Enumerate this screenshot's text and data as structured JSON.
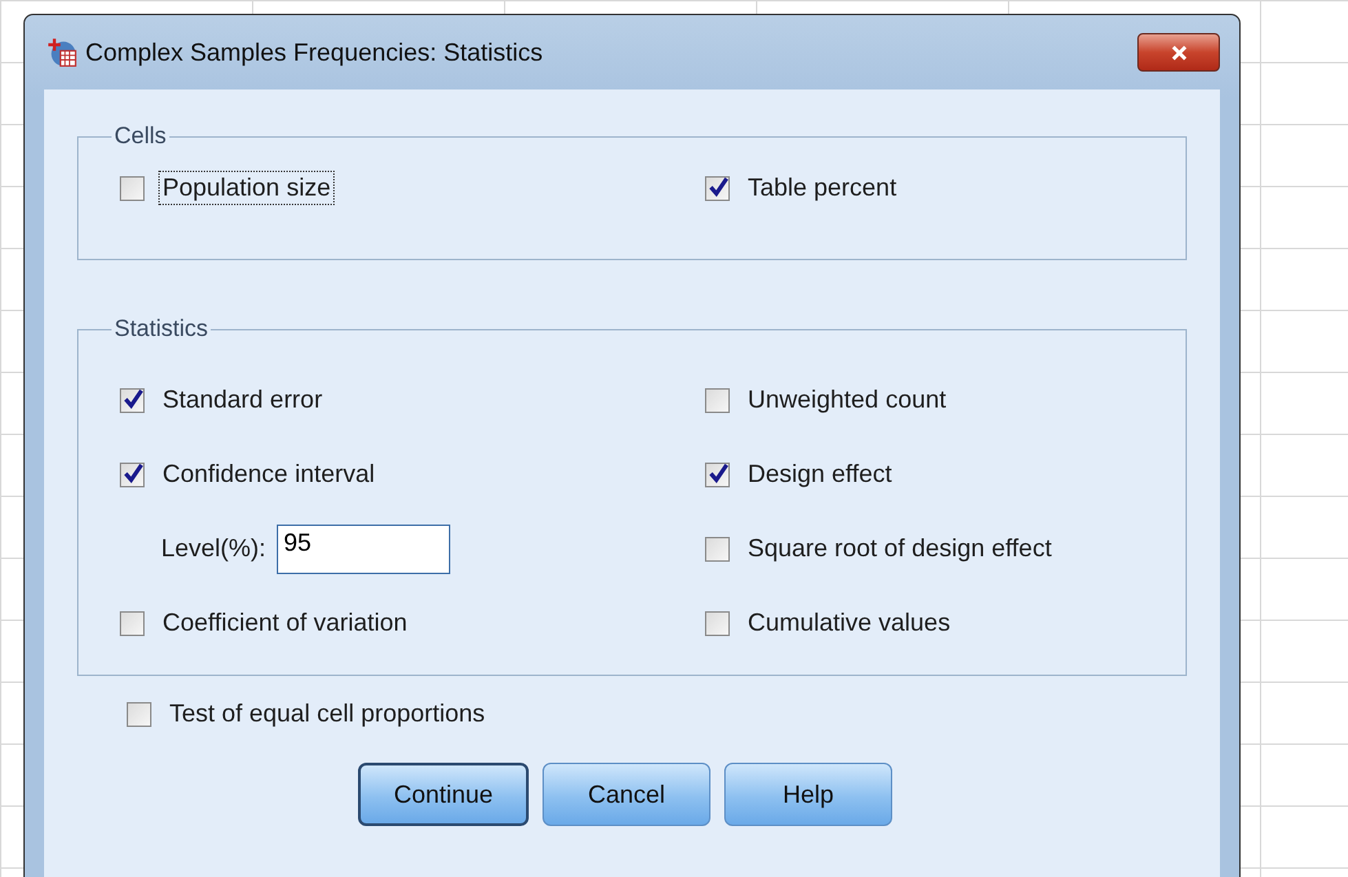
{
  "window": {
    "title": "Complex Samples Frequencies: Statistics"
  },
  "cells": {
    "title": "Cells",
    "options": [
      {
        "label": "Population size",
        "checked": false,
        "focused": true
      },
      {
        "label": "Table percent",
        "checked": true,
        "focused": false
      }
    ]
  },
  "statistics": {
    "title": "Statistics",
    "left": [
      {
        "kind": "checkbox",
        "label": "Standard error",
        "checked": true
      },
      {
        "kind": "checkbox",
        "label": "Confidence interval",
        "checked": true
      },
      {
        "kind": "field",
        "label": "Level(%):",
        "value": "95"
      },
      {
        "kind": "checkbox",
        "label": "Coefficient of variation",
        "checked": false
      }
    ],
    "right": [
      {
        "kind": "checkbox",
        "label": "Unweighted count",
        "checked": false
      },
      {
        "kind": "checkbox",
        "label": "Design effect",
        "checked": true
      },
      {
        "kind": "checkbox",
        "label": "Square root of design effect",
        "checked": false
      },
      {
        "kind": "checkbox",
        "label": "Cumulative values",
        "checked": false
      }
    ]
  },
  "test": {
    "label": "Test of equal cell proportions",
    "checked": false
  },
  "buttons": [
    {
      "label": "Continue",
      "default": true
    },
    {
      "label": "Cancel",
      "default": false
    },
    {
      "label": "Help",
      "default": false
    }
  ]
}
